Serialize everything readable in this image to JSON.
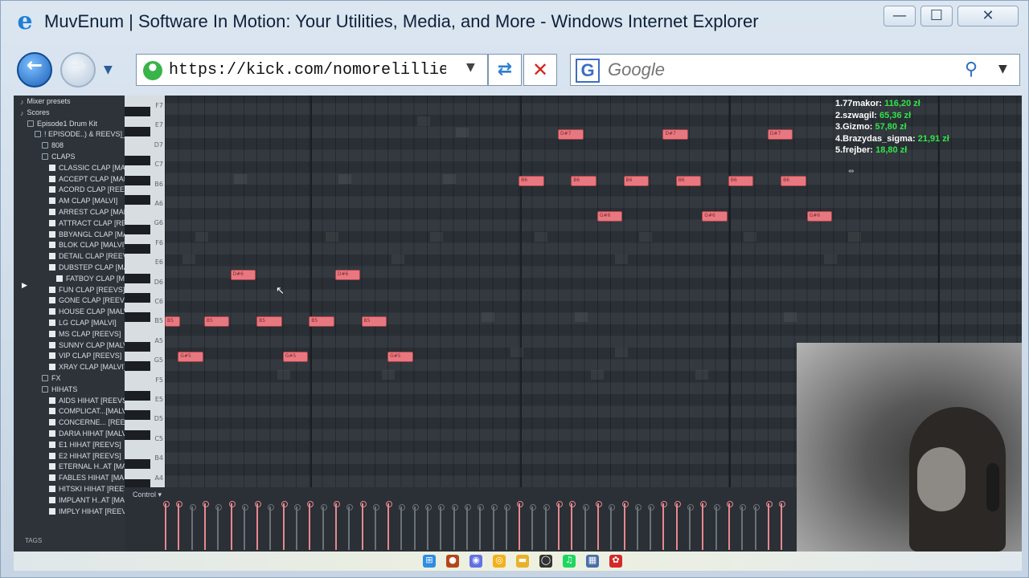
{
  "window": {
    "title": "MuvEnum | Software In Motion: Your Utilities, Media, and More - Windows Internet Explorer",
    "minimize": "—",
    "maximize": "☐",
    "close": "✕"
  },
  "navbar": {
    "address": "https://kick.com/nomorelillie",
    "search_placeholder": "Google",
    "google_letter": "G"
  },
  "browser": {
    "items": [
      {
        "label": "Mixer presets",
        "icon": "preset",
        "indent": 0
      },
      {
        "label": "Scores",
        "icon": "preset",
        "indent": 0
      },
      {
        "label": "Episode1 Drum Kit",
        "icon": "folder",
        "indent": 1
      },
      {
        "label": "! EPISODE..) & REEVS]_",
        "icon": "folder",
        "indent": 2
      },
      {
        "label": "808",
        "icon": "folder",
        "indent": 3
      },
      {
        "label": "CLAPS",
        "icon": "folder",
        "indent": 3
      },
      {
        "label": "CLASSIC CLAP [MALVI]",
        "icon": "file",
        "indent": 4
      },
      {
        "label": "ACCEPT CLAP [MALVI]",
        "icon": "file",
        "indent": 4
      },
      {
        "label": "ACORD CLAP [REEVS]",
        "icon": "file",
        "indent": 4
      },
      {
        "label": "AM CLAP [MALVI]",
        "icon": "file",
        "indent": 4
      },
      {
        "label": "ARREST CLAP [MALVI]",
        "icon": "file",
        "indent": 4
      },
      {
        "label": "ATTRACT CLAP [REEVS]",
        "icon": "file",
        "indent": 4
      },
      {
        "label": "BBYANGL CLAP [MALVI]",
        "icon": "file",
        "indent": 4
      },
      {
        "label": "BLOK CLAP [MALVI]",
        "icon": "file",
        "indent": 4
      },
      {
        "label": "DETAIL CLAP [REEVS]",
        "icon": "file",
        "indent": 4
      },
      {
        "label": "DUBSTEP CLAP [MALVI]",
        "icon": "file",
        "indent": 4
      },
      {
        "label": "FATBOY CLAP [MALVI]",
        "icon": "file",
        "indent": 5
      },
      {
        "label": "FUN CLAP [REEVS]",
        "icon": "file",
        "indent": 4
      },
      {
        "label": "GONE CLAP [REEVS]",
        "icon": "file",
        "indent": 4
      },
      {
        "label": "HOUSE CLAP [MALVI]",
        "icon": "file",
        "indent": 4
      },
      {
        "label": "LG CLAP [MALVI]",
        "icon": "file",
        "indent": 4
      },
      {
        "label": "MS CLAP [REEVS]",
        "icon": "file",
        "indent": 4
      },
      {
        "label": "SUNNY CLAP [MALVI]",
        "icon": "file",
        "indent": 4
      },
      {
        "label": "VIP CLAP [REEVS]",
        "icon": "file",
        "indent": 4
      },
      {
        "label": "XRAY CLAP [MALVI]",
        "icon": "file",
        "indent": 4
      },
      {
        "label": "FX",
        "icon": "folder",
        "indent": 3
      },
      {
        "label": "HIHATS",
        "icon": "folder",
        "indent": 3
      },
      {
        "label": "AIDS HIHAT [REEVS]",
        "icon": "file",
        "indent": 4
      },
      {
        "label": "COMPLICAT...[MALVI]",
        "icon": "file",
        "indent": 4
      },
      {
        "label": "CONCERNE... [REEVS]",
        "icon": "file",
        "indent": 4
      },
      {
        "label": "DARIA HIHAT [MALVI]",
        "icon": "file",
        "indent": 4
      },
      {
        "label": "E1 HIHAT [REEVS]",
        "icon": "file",
        "indent": 4
      },
      {
        "label": "E2 HIHAT [REEVS]",
        "icon": "file",
        "indent": 4
      },
      {
        "label": "ETERNAL H..AT [MALVI]",
        "icon": "file",
        "indent": 4
      },
      {
        "label": "FABLES HIHAT [MALVI]",
        "icon": "file",
        "indent": 4
      },
      {
        "label": "HITSKI HIHAT [REEVS]",
        "icon": "file",
        "indent": 4
      },
      {
        "label": "IMPLANT H..AT [MALVI]",
        "icon": "file",
        "indent": 4
      },
      {
        "label": "IMPLY HIHAT [REEVS]",
        "icon": "file",
        "indent": 4
      }
    ],
    "tags": "TAGS"
  },
  "keyboard": {
    "octave_labels": [
      "F7",
      "E7",
      "D7",
      "C7",
      "B6",
      "A6",
      "G6",
      "F6",
      "E6",
      "D6",
      "C6",
      "B5",
      "A5",
      "G5",
      "F5",
      "E5",
      "D5",
      "C5",
      "B4",
      "A4"
    ]
  },
  "notes": [
    {
      "pitch": "D#7",
      "row": 1.5,
      "start": 30,
      "len": 2
    },
    {
      "pitch": "D#7",
      "row": 1.5,
      "start": 38,
      "len": 2
    },
    {
      "pitch": "D#7",
      "row": 1.5,
      "start": 46,
      "len": 2
    },
    {
      "pitch": "B6",
      "row": 3.5,
      "start": 27,
      "len": 2
    },
    {
      "pitch": "B6",
      "row": 3.5,
      "start": 31,
      "len": 2
    },
    {
      "pitch": "B6",
      "row": 3.5,
      "start": 35,
      "len": 2
    },
    {
      "pitch": "B6",
      "row": 3.5,
      "start": 39,
      "len": 2
    },
    {
      "pitch": "B6",
      "row": 3.5,
      "start": 43,
      "len": 2
    },
    {
      "pitch": "B6",
      "row": 3.5,
      "start": 47,
      "len": 2
    },
    {
      "pitch": "G#6",
      "row": 5,
      "start": 33,
      "len": 2
    },
    {
      "pitch": "G#6",
      "row": 5,
      "start": 41,
      "len": 2
    },
    {
      "pitch": "G#6",
      "row": 5,
      "start": 49,
      "len": 2
    },
    {
      "pitch": "D#6",
      "row": 7.5,
      "start": 5,
      "len": 2
    },
    {
      "pitch": "D#6",
      "row": 7.5,
      "start": 13,
      "len": 2
    },
    {
      "pitch": "B5",
      "row": 9.5,
      "start": 0,
      "len": 1.2
    },
    {
      "pitch": "B5",
      "row": 9.5,
      "start": 3,
      "len": 2
    },
    {
      "pitch": "B5",
      "row": 9.5,
      "start": 7,
      "len": 2
    },
    {
      "pitch": "B5",
      "row": 9.5,
      "start": 11,
      "len": 2
    },
    {
      "pitch": "B5",
      "row": 9.5,
      "start": 15,
      "len": 2
    },
    {
      "pitch": "G#5",
      "row": 11,
      "start": 1,
      "len": 2
    },
    {
      "pitch": "G#5",
      "row": 11,
      "start": 9,
      "len": 2
    },
    {
      "pitch": "G#5",
      "row": 11,
      "start": 17,
      "len": 2
    }
  ],
  "leaderboard": [
    {
      "rank_name": "1.77makor:",
      "amount": "116,20 zł"
    },
    {
      "rank_name": "2.szwagil:",
      "amount": "65,36 zł"
    },
    {
      "rank_name": "3.Gizmo:",
      "amount": "57,80 zł"
    },
    {
      "rank_name": "4.Brazydas_sigma:",
      "amount": "21,91 zł"
    },
    {
      "rank_name": "5.frejber:",
      "amount": "18,80 zł"
    }
  ],
  "control": {
    "label": "Control ▾"
  },
  "taskbar": {
    "icons": [
      "windows-start-icon",
      "app-icon",
      "discord-icon",
      "chrome-icon",
      "file-explorer-icon",
      "obs-icon",
      "spotify-icon",
      "calculator-icon",
      "fl-studio-icon"
    ]
  }
}
